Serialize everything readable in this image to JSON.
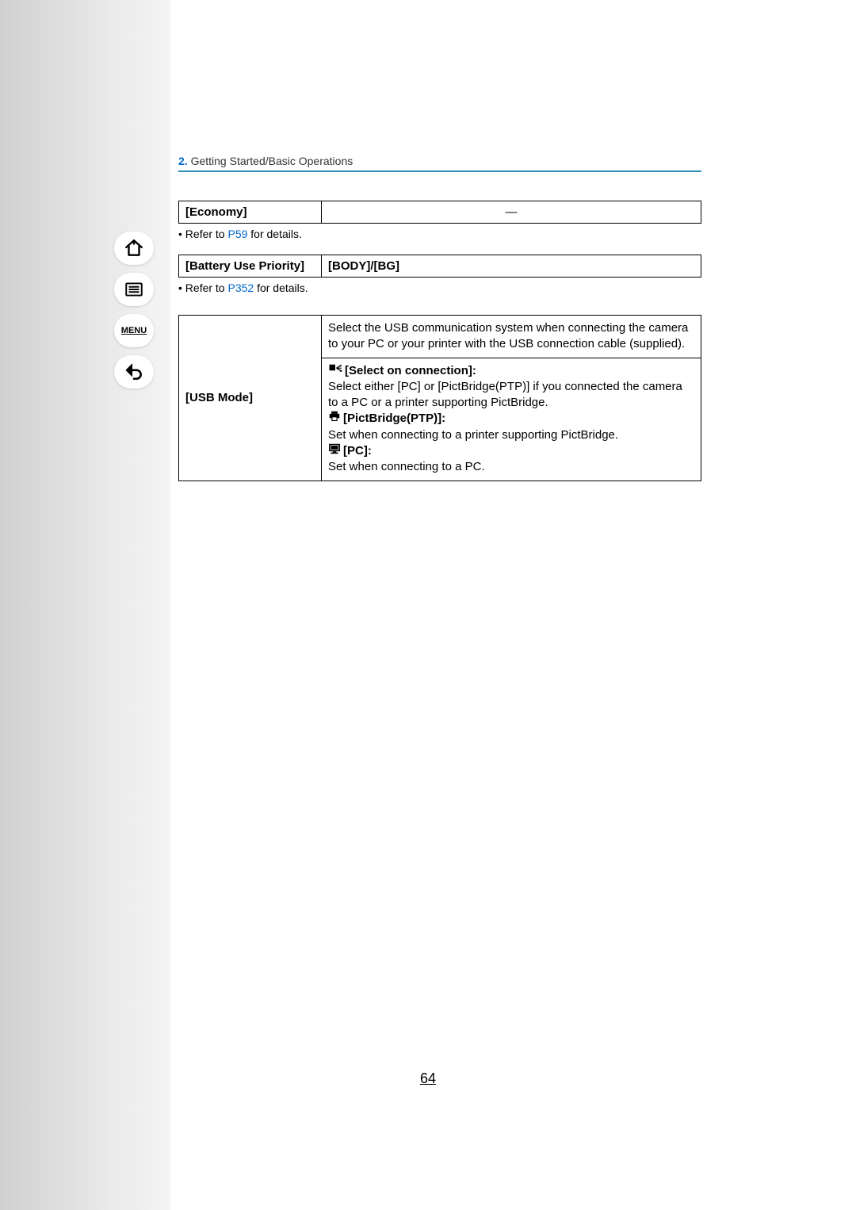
{
  "header": {
    "section_number": "2.",
    "section_title": "Getting Started/Basic Operations"
  },
  "sidebar": {
    "menu_label": "MENU"
  },
  "economy": {
    "label": "[Economy]",
    "value": "—",
    "refer_prefix": "• Refer to ",
    "refer_link": "P59",
    "refer_suffix": " for details."
  },
  "battery": {
    "label": "[Battery Use Priority]",
    "value": "[BODY]/[BG]",
    "refer_prefix": "• Refer to ",
    "refer_link": "P352",
    "refer_suffix": " for details."
  },
  "usb": {
    "label": "[USB Mode]",
    "desc": "Select the USB communication system when connecting the camera to your PC or your printer with the USB connection cable (supplied).",
    "opt1_label": "[Select on connection]:",
    "opt1_text": "Select either [PC] or [PictBridge(PTP)] if you connected the camera to a PC or a printer supporting PictBridge.",
    "opt2_label": "[PictBridge(PTP)]:",
    "opt2_text": "Set when connecting to a printer supporting PictBridge.",
    "opt3_label": "[PC]:",
    "opt3_text": "Set when connecting to a PC."
  },
  "page_number": "64"
}
